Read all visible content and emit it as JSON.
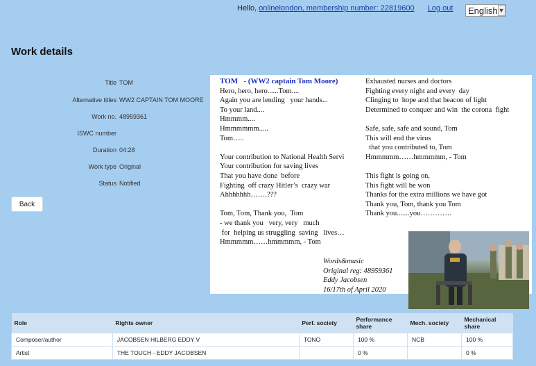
{
  "topbar": {
    "greeting": "Hello,",
    "user_link": "onlinelondon, membership number: 22819600",
    "logout": "Log out"
  },
  "language": {
    "selected": "English",
    "icon": "chevron-down-icon"
  },
  "page_title": "Work details",
  "details": [
    {
      "label": "Title",
      "value": "TOM"
    },
    {
      "label": "Alternative titles",
      "value": "WW2 CAPTAIN TOM MOORE"
    },
    {
      "label": "Work no.",
      "value": "48959361"
    },
    {
      "label": "ISWC number",
      "value": ""
    },
    {
      "label": "Duration",
      "value": "04:28"
    },
    {
      "label": "Work type",
      "value": "Original"
    },
    {
      "label": "Status",
      "value": "Notified"
    }
  ],
  "back_label": "Back",
  "lyrics": {
    "col1": [
      "TOM   - (WW2 captain Tom Moore)",
      "Hero, hero, hero......Tom....",
      "Again you are lending   your hands...",
      "To your land....",
      "Hmmmm....",
      "Hmmmmmm.....",
      "Tom…..",
      "",
      "Your contribution to National Health Servi",
      "Your contribution for saving lives",
      "That you have done  before",
      "Fighting  off crazy Hitler’s  crazy war",
      "Ahhhhhhh…….???",
      "",
      "Tom, Tom, Thank you,  Tom",
      "- we thank you   very, very   much",
      " for  helping us struggling  saving   lives…",
      "Hmmmmm……hmmmmm, - Tom"
    ],
    "col2": [
      "Exhausted nurses and doctors",
      "Fighting every night and every  day",
      "Clinging to  hope and that beacon of light",
      "Determined to conquer and win  the corona  fight",
      "",
      "Safe, safe, safe and sound, Tom",
      "This will end the virus",
      "  that you contributed to, Tom",
      "Hmmmmm……hmmmmm, - Tom",
      "",
      "This fight is going on,",
      "This fight will be won",
      "Thanks for the extra millions we have got",
      "Thank you, Tom, thank you Tom",
      "Thank you.......you…………."
    ],
    "signature": [
      "Words&music",
      "Original reg: 48959361",
      "Eddy Jacobsen",
      "16/17th of April 2020"
    ]
  },
  "rights_table": {
    "headers": [
      "Role",
      "Rights owner",
      "Perf. society",
      "Performance share",
      "Mech. society",
      "Mechanical share"
    ],
    "rows": [
      [
        "Composer/author",
        "JACOBSEN HILBERG EDDY V",
        "TONO",
        "100 %",
        "NCB",
        "100 %"
      ],
      [
        "Artist",
        "THE TOUCH - EDDY JACOBSEN",
        "",
        "0 %",
        "",
        "0 %"
      ]
    ]
  }
}
